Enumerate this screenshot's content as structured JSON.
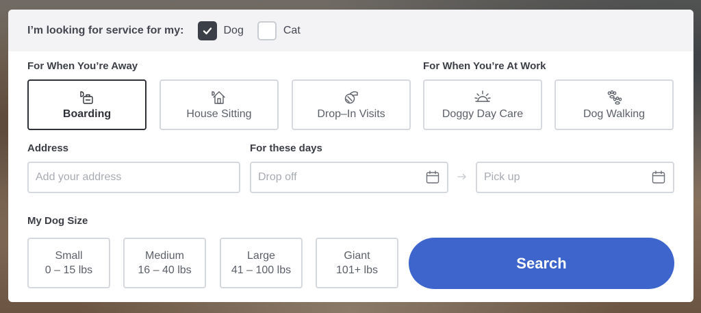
{
  "pet_selector": {
    "prompt": "I’m looking for service for my:",
    "options": [
      {
        "label": "Dog",
        "checked": true
      },
      {
        "label": "Cat",
        "checked": false
      }
    ]
  },
  "sections": {
    "away_label": "For When You’re Away",
    "work_label": "For When You’re At Work"
  },
  "services": [
    {
      "label": "Boarding",
      "icon": "boarding-icon",
      "selected": true
    },
    {
      "label": "House Sitting",
      "icon": "house-sitting-icon",
      "selected": false
    },
    {
      "label": "Drop–In Visits",
      "icon": "drop-in-icon",
      "selected": false
    },
    {
      "label": "Doggy Day Care",
      "icon": "sun-icon",
      "selected": false
    },
    {
      "label": "Dog Walking",
      "icon": "paw-icon",
      "selected": false
    }
  ],
  "address": {
    "label": "Address",
    "placeholder": "Add your address"
  },
  "dates": {
    "label": "For these days",
    "dropoff_placeholder": "Drop off",
    "pickup_placeholder": "Pick up"
  },
  "dog_size": {
    "label": "My Dog Size",
    "options": [
      {
        "name": "Small",
        "range": "0 – 15 lbs"
      },
      {
        "name": "Medium",
        "range": "16 – 40 lbs"
      },
      {
        "name": "Large",
        "range": "41 – 100 lbs"
      },
      {
        "name": "Giant",
        "range": "101+ lbs"
      }
    ]
  },
  "search_button": "Search",
  "colors": {
    "accent": "#3d65cb",
    "selected_border": "#2e3137",
    "border": "#d5d8dc"
  }
}
